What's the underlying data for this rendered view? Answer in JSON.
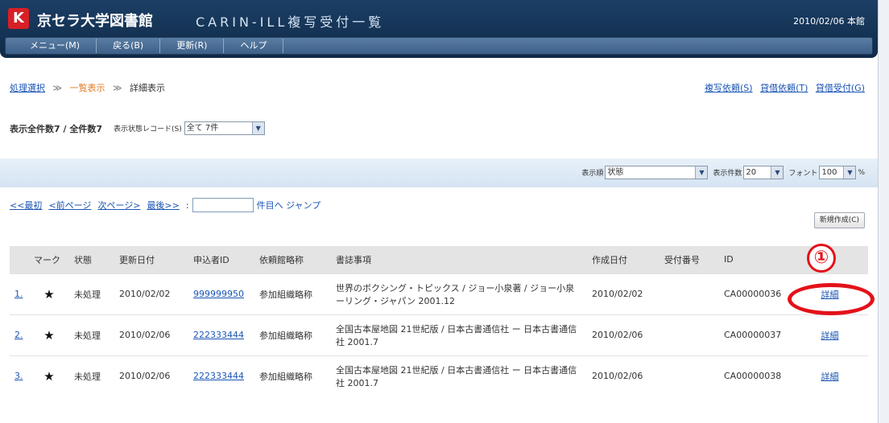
{
  "header": {
    "logo": "K",
    "title": "京セラ大学図書館",
    "subtitle": "CARIN-ILL複写受付一覧",
    "date": "2010/02/06 本館",
    "menu": [
      "メニュー(M)",
      "戻る(B)",
      "更新(R)",
      "ヘルプ"
    ]
  },
  "breadcrumb": {
    "items": [
      "処理選択",
      "一覧表示",
      "詳細表示"
    ],
    "separator": "≫"
  },
  "top_links": [
    "複写依頼(S)",
    "貸借依頼(T)",
    "貸借受付(G)"
  ],
  "counts": {
    "text": "表示全件数7 / 全件数7",
    "record_label": "表示状態レコード(S)",
    "record_value": "全て 7件"
  },
  "controls": {
    "sort_label": "表示順",
    "sort_value": "状態",
    "count_label": "表示件数",
    "count_value": "20",
    "font_label": "フォント",
    "font_value": "100",
    "percent": "%"
  },
  "pager": {
    "first": "<<最初",
    "prev": "<前ページ",
    "next": "次ページ>",
    "last": "最後>>",
    "colon": ":",
    "jump_suffix": "件目へ ジャンプ"
  },
  "new_button": "新規作成(C)",
  "table": {
    "headers": [
      "",
      "マーク",
      "状態",
      "更新日付",
      "申込者ID",
      "依頼館略称",
      "書誌事項",
      "作成日付",
      "受付番号",
      "ID",
      ""
    ],
    "rows": [
      {
        "no": "1.",
        "mark": "★",
        "status": "未処理",
        "updated": "2010/02/02",
        "applicant": "999999950",
        "lib": "参加組織略称",
        "biblio": "世界のボクシング・トピックス / ジョー小泉著 / ジョー小泉 ーリング・ジャパン 2001.12",
        "created": "2010/02/02",
        "receipt": "",
        "id": "CA00000036",
        "detail": "詳細"
      },
      {
        "no": "2.",
        "mark": "★",
        "status": "未処理",
        "updated": "2010/02/06",
        "applicant": "222333444",
        "lib": "参加組織略称",
        "biblio": "全国古本屋地図 21世紀版 / 日本古書通信社 ー 日本古書通信社 2001.7",
        "created": "2010/02/06",
        "receipt": "",
        "id": "CA00000037",
        "detail": "詳細"
      },
      {
        "no": "3.",
        "mark": "★",
        "status": "未処理",
        "updated": "2010/02/06",
        "applicant": "222333444",
        "lib": "参加組織略称",
        "biblio": "全国古本屋地図 21世紀版 / 日本古書通信社 ー 日本古書通信社 2001.7",
        "created": "2010/02/06",
        "receipt": "",
        "id": "CA00000038",
        "detail": "詳細"
      }
    ]
  },
  "annotation": {
    "marker": "①"
  },
  "colors": {
    "header_bg": "#143659",
    "accent_orange": "#e57a1f",
    "link": "#1a55b3",
    "annotation_red": "#e3121a"
  }
}
